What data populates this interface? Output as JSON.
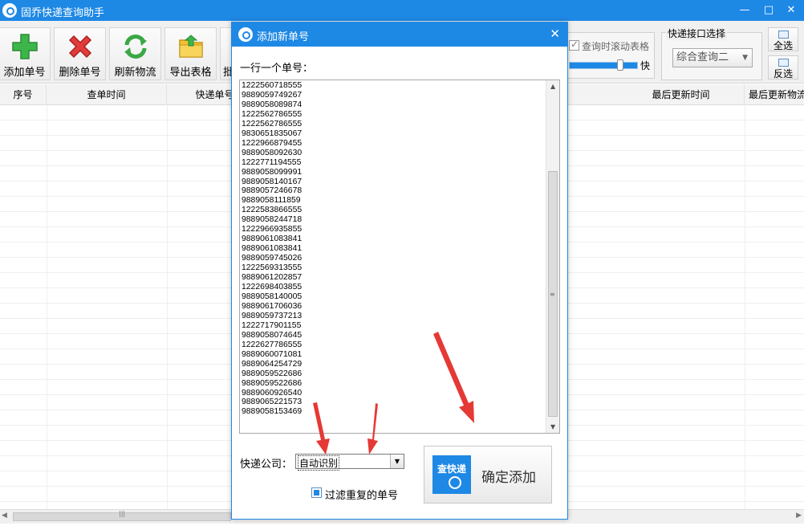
{
  "app": {
    "title": "固乔快递查询助手",
    "window_controls": [
      "—",
      "□",
      "✕"
    ]
  },
  "toolbar": {
    "add_label": "添加单号",
    "delete_label": "删除单号",
    "refresh_label": "刷新物流",
    "export_label": "导出表格",
    "partial_label": "批",
    "scroll_table_label": "查询时滚动表格",
    "scroll_table_checked": true,
    "speed_label": "快",
    "speed_value_fraction": 0.8,
    "api_group_title": "快递接口选择",
    "api_selected": "综合查询二",
    "select_all_label": "全选",
    "invert_label": "反选"
  },
  "table": {
    "columns": [
      "序号",
      "查单时间",
      "快递单号",
      "最后更新时间",
      "最后更新物流"
    ]
  },
  "dialog": {
    "title": "添加新单号",
    "close_icon": "✕",
    "hint": "一行一个单号：",
    "numbers": [
      "1222560718555",
      "9889059749267",
      "9889058089874",
      "1222562786555",
      "1222562786555",
      "9830651835067",
      "1222966879455",
      "9889058092630",
      "1222771194555",
      "9889058099991",
      "9889058140167",
      "9889057246678",
      "9889058111859",
      "1222583866555",
      "9889058244718",
      "1222966935855",
      "9889061083841",
      "9889061083841",
      "9889059745026",
      "1222569313555",
      "9889061202857",
      "1222698403855",
      "9889058140005",
      "9889061706036",
      "9889059737213",
      "1222717901155",
      "9889058074645",
      "1222627786555",
      "9889060071081",
      "9889064254729",
      "9889059522686",
      "9889059522686",
      "9889060926540",
      "9889065221573",
      "9889058153469"
    ],
    "courier_label": "快递公司：",
    "courier_value": "自动识别",
    "filter_label": "过滤重复的单号",
    "filter_checked": true,
    "confirm_label": "确定添加",
    "confirm_logo_text": "查快递"
  },
  "colors": {
    "accent": "#1e88e5",
    "annotation_arrow": "#e53935"
  }
}
